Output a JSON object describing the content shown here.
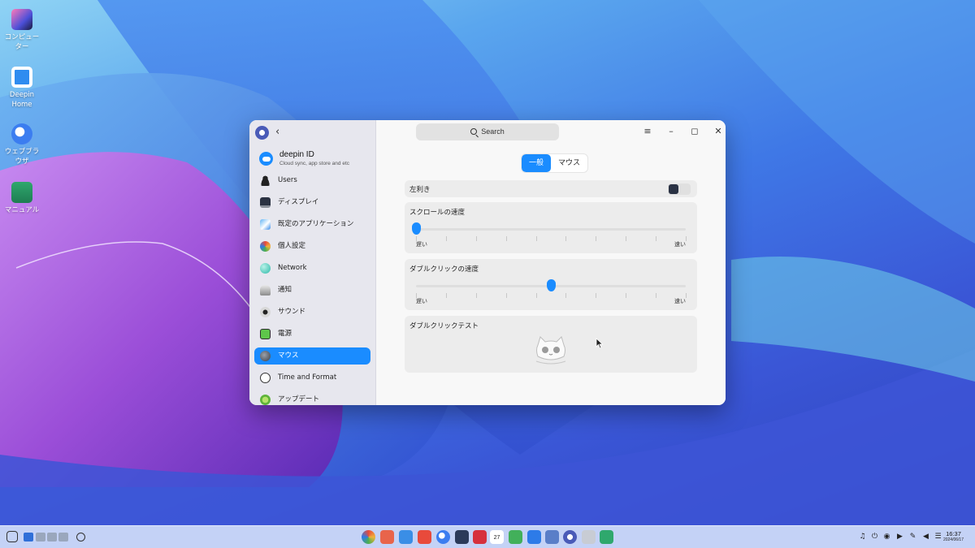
{
  "desktop": {
    "icons": [
      {
        "label": "コンピューター"
      },
      {
        "label": "Deepin Home"
      },
      {
        "label": "ウェブブラウザ"
      },
      {
        "label": "マニュアル"
      }
    ]
  },
  "window": {
    "search_placeholder": "Search",
    "account": {
      "name": "deepin ID",
      "subtitle": "Cloud sync, app store and etc"
    },
    "nav": [
      {
        "label": "Users"
      },
      {
        "label": "ディスプレイ"
      },
      {
        "label": "既定のアプリケーション"
      },
      {
        "label": "個人設定"
      },
      {
        "label": "Network"
      },
      {
        "label": "通知"
      },
      {
        "label": "サウンド"
      },
      {
        "label": "電源"
      },
      {
        "label": "マウス"
      },
      {
        "label": "Time and Format"
      },
      {
        "label": "アップデート"
      }
    ],
    "tabs": [
      {
        "label": "一般"
      },
      {
        "label": "マウス"
      }
    ],
    "left_hand": {
      "label": "左利き",
      "enabled": false
    },
    "scroll_speed": {
      "label": "スクロールの速度",
      "value": 0,
      "slow": "遅い",
      "fast": "速い"
    },
    "double_click_speed": {
      "label": "ダブルクリックの速度",
      "value": 0.5,
      "slow": "遅い",
      "fast": "速い"
    },
    "double_click_test": {
      "label": "ダブルクリックテスト"
    }
  },
  "taskbar": {
    "calendar_day": "27",
    "time": "16:37",
    "date": "2024/06/17"
  },
  "colors": {
    "accent": "#1a8cff",
    "sidebar": "#e7e7ee"
  }
}
